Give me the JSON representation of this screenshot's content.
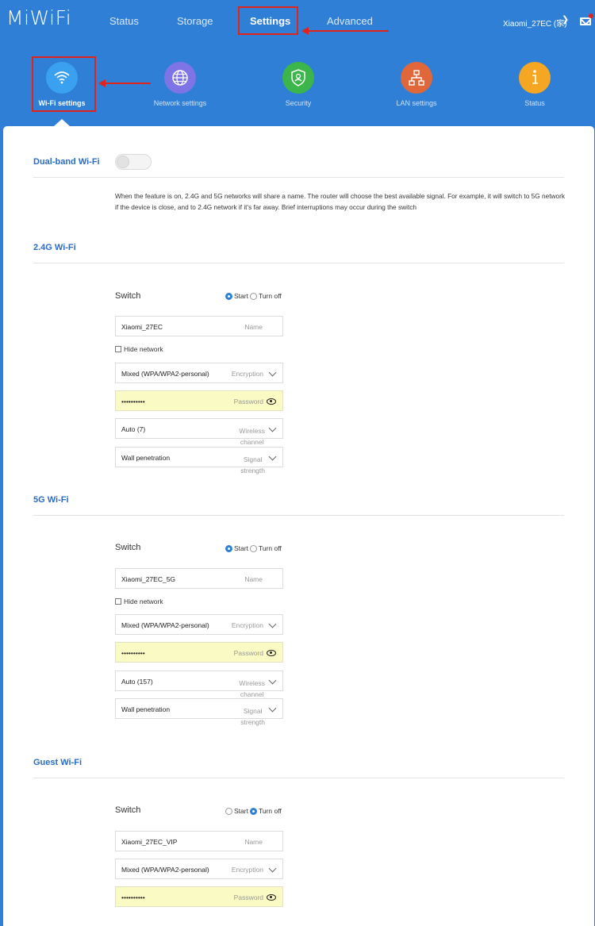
{
  "app": {
    "logo": "MiWiFi"
  },
  "nav": {
    "items": [
      {
        "label": "Status"
      },
      {
        "label": "Storage"
      },
      {
        "label": "Settings"
      },
      {
        "label": "Advanced"
      }
    ],
    "active": "Settings"
  },
  "user": {
    "name": "Xiaomi_27EC (家)"
  },
  "subnav": {
    "items": [
      {
        "label": "Wi-Fi settings",
        "icon": "wifi-icon",
        "color": "#3aa0f0"
      },
      {
        "label": "Network settings",
        "icon": "globe-icon",
        "color": "#7f74e6"
      },
      {
        "label": "Security",
        "icon": "shield-icon",
        "color": "#3cb54a"
      },
      {
        "label": "LAN settings",
        "icon": "lan-icon",
        "color": "#e0673a"
      },
      {
        "label": "Status",
        "icon": "info-icon",
        "color": "#f5a623"
      }
    ],
    "active": "Wi-Fi settings"
  },
  "colors": {
    "accent": "#2f7fd6",
    "highlight": "#e0231b",
    "password_bg": "#fafac4"
  },
  "dual_band": {
    "title": "Dual-band Wi-Fi",
    "enabled": false,
    "description": "When the feature is on, 2.4G and 5G networks will share a name. The router will choose the best available signal. For example, it will switch to 5G network if the device is close, and to 2.4G network if it's far away. Brief interruptions may occur during the switch"
  },
  "wifi24": {
    "title": "2.4G Wi-Fi",
    "switch_label": "Switch",
    "opt_start": "Start",
    "opt_off": "Turn off",
    "selected": "Start",
    "name_value": "Xiaomi_27EC",
    "name_hint": "Name",
    "hide_network": "Hide network",
    "encryption_value": "Mixed (WPA/WPA2-personal)",
    "encryption_hint": "Encryption",
    "password_value": "••••••••••",
    "password_hint": "Password",
    "channel_value": "Auto (7)",
    "channel_hint_1": "Wireless",
    "channel_hint_2": "channel",
    "signal_value": "Wall penetration",
    "signal_hint_1": "Signal",
    "signal_hint_2": "strength"
  },
  "wifi5": {
    "title": "5G Wi-Fi",
    "switch_label": "Switch",
    "opt_start": "Start",
    "opt_off": "Turn off",
    "selected": "Start",
    "name_value": "Xiaomi_27EC_5G",
    "name_hint": "Name",
    "hide_network": "Hide network",
    "encryption_value": "Mixed (WPA/WPA2-personal)",
    "encryption_hint": "Encryption",
    "password_value": "••••••••••",
    "password_hint": "Password",
    "channel_value": "Auto (157)",
    "channel_hint_1": "Wireless",
    "channel_hint_2": "channel",
    "signal_value": "Wall penetration",
    "signal_hint_1": "Signal",
    "signal_hint_2": "strength"
  },
  "guest": {
    "title": "Guest Wi-Fi",
    "switch_label": "Switch",
    "opt_start": "Start",
    "opt_off": "Turn off",
    "selected": "Turn off",
    "name_value": "Xiaomi_27EC_VIP",
    "name_hint": "Name",
    "encryption_value": "Mixed (WPA/WPA2-personal)",
    "encryption_hint": "Encryption",
    "password_value": "••••••••••",
    "password_hint": "Password"
  }
}
